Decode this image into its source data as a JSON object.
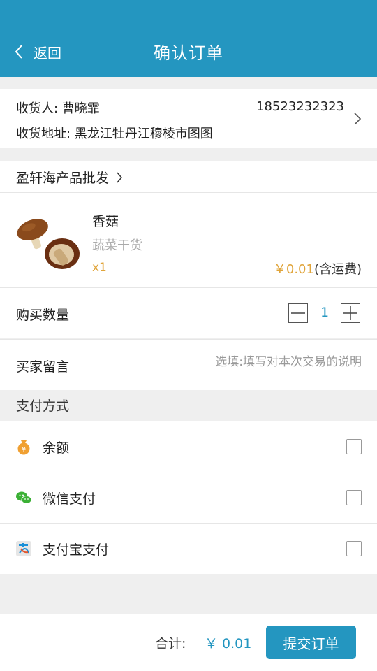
{
  "header": {
    "back_label": "返回",
    "title": "确认订单"
  },
  "address": {
    "recipient_label": "收货人: ",
    "recipient_name": "曹晓霏",
    "phone": "18523232323",
    "address_label": "收货地址: ",
    "address_value": "黑龙江牡丹江穆棱市图图"
  },
  "shop": {
    "name": "盈轩海产品批发"
  },
  "product": {
    "name": "香菇",
    "category": "蔬菜干货",
    "qty": "x1",
    "price": "￥0.01",
    "price_note": "(含运费)"
  },
  "quantity": {
    "label": "购买数量",
    "value": "1"
  },
  "message": {
    "label": "买家留言",
    "placeholder": "选填:填写对本次交易的说明"
  },
  "payment": {
    "title": "支付方式",
    "options": [
      {
        "label": "余额",
        "icon": "money-bag-icon",
        "checked": false
      },
      {
        "label": "微信支付",
        "icon": "wechat-icon",
        "checked": false
      },
      {
        "label": "支付宝支付",
        "icon": "alipay-icon",
        "checked": false
      }
    ]
  },
  "footer": {
    "total_label": "合计:",
    "total_value": "￥ 0.01",
    "submit_label": "提交订单"
  },
  "colors": {
    "primary": "#2496c0",
    "price": "#e0a43a",
    "background": "#efefef"
  }
}
